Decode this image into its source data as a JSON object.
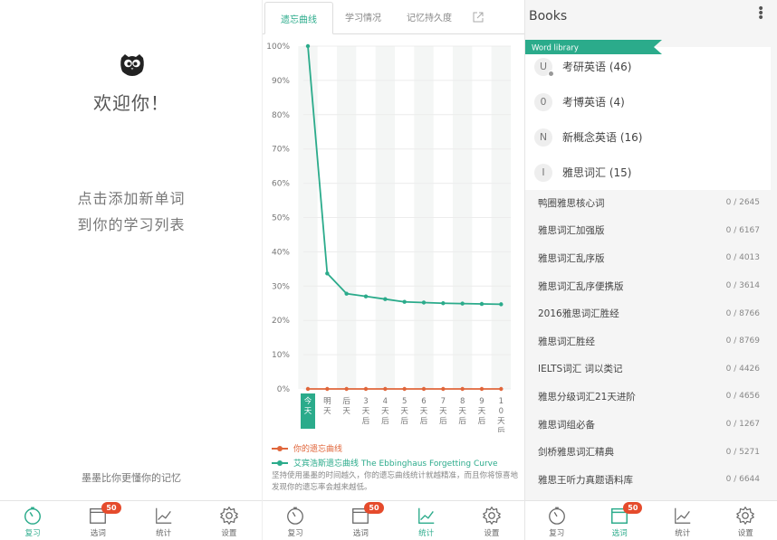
{
  "panel1": {
    "welcome": "欢迎你！",
    "hint_line1": "点击添加新单词",
    "hint_line2": "到你的学习列表",
    "footnote": "墨墨比你更懂你的记忆"
  },
  "nav": {
    "review": "复习",
    "pick": "选词",
    "stats": "统计",
    "settings": "设置",
    "badge": "50"
  },
  "panel2": {
    "tabs": [
      "遗忘曲线",
      "学习情况",
      "记忆持久度"
    ],
    "legend_mine": "你的遗忘曲线",
    "legend_ebbinghaus": "艾宾浩斯遗忘曲线 The Ebbinghaus Forgetting Curve",
    "note": "坚持使用墨墨的时间越久，你的遗忘曲线统计就越精准，而且你将惊喜地发现你的遗忘率会越来越低。"
  },
  "chart_data": {
    "type": "line",
    "categories": [
      "今天",
      "明天",
      "后天",
      "3天后",
      "4天后",
      "5天后",
      "6天后",
      "7天后",
      "8天后",
      "9天后",
      "10天后"
    ],
    "ylim": [
      0,
      100
    ],
    "yticks": [
      "100%",
      "90%",
      "80%",
      "70%",
      "60%",
      "50%",
      "40%",
      "30%",
      "20%",
      "10%",
      "0%"
    ],
    "series": [
      {
        "name": "你的遗忘曲线",
        "color": "#e0663b",
        "values": [
          0,
          0,
          0,
          0,
          0,
          0,
          0,
          0,
          0,
          0,
          0
        ]
      },
      {
        "name": "艾宾浩斯遗忘曲线 The Ebbinghaus Forgetting Curve",
        "color": "#2bab8b",
        "values": [
          100,
          33.7,
          27.8,
          27,
          26.2,
          25.4,
          25.2,
          25,
          24.9,
          24.8,
          24.7
        ]
      }
    ],
    "highlight_category": "今天",
    "grid": true
  },
  "panel3": {
    "title": "Books",
    "ribbon": "Word library",
    "libraries": [
      {
        "initial": "U",
        "label": "考研英语 (46)"
      },
      {
        "initial": "0",
        "label": "考博英语 (4)"
      },
      {
        "initial": "N",
        "label": "新概念英语 (16)"
      },
      {
        "initial": "I",
        "label": "雅思词汇 (15)"
      }
    ],
    "books": [
      {
        "name": "鸭圈雅思核心词",
        "count": "0 / 2645"
      },
      {
        "name": "雅思词汇加强版",
        "count": "0 / 6167"
      },
      {
        "name": "雅思词汇乱序版",
        "count": "0 / 4013"
      },
      {
        "name": "雅思词汇乱序便携版",
        "count": "0 / 3614"
      },
      {
        "name": "2016雅思词汇胜经",
        "count": "0 / 8766"
      },
      {
        "name": "雅思词汇胜经",
        "count": "0 / 8769"
      },
      {
        "name": "IELTS词汇  词以类记",
        "count": "0 / 4426"
      },
      {
        "name": "雅思分级词汇21天进阶",
        "count": "0 / 4656"
      },
      {
        "name": "雅思词组必备",
        "count": "0 / 1267"
      },
      {
        "name": "剑桥雅思词汇精典",
        "count": "0 / 5271"
      },
      {
        "name": "雅思王听力真题语料库",
        "count": "0 / 6644"
      }
    ]
  },
  "colors": {
    "accent": "#2bab8b",
    "mine": "#e0663b",
    "badge": "#e54b2c"
  }
}
